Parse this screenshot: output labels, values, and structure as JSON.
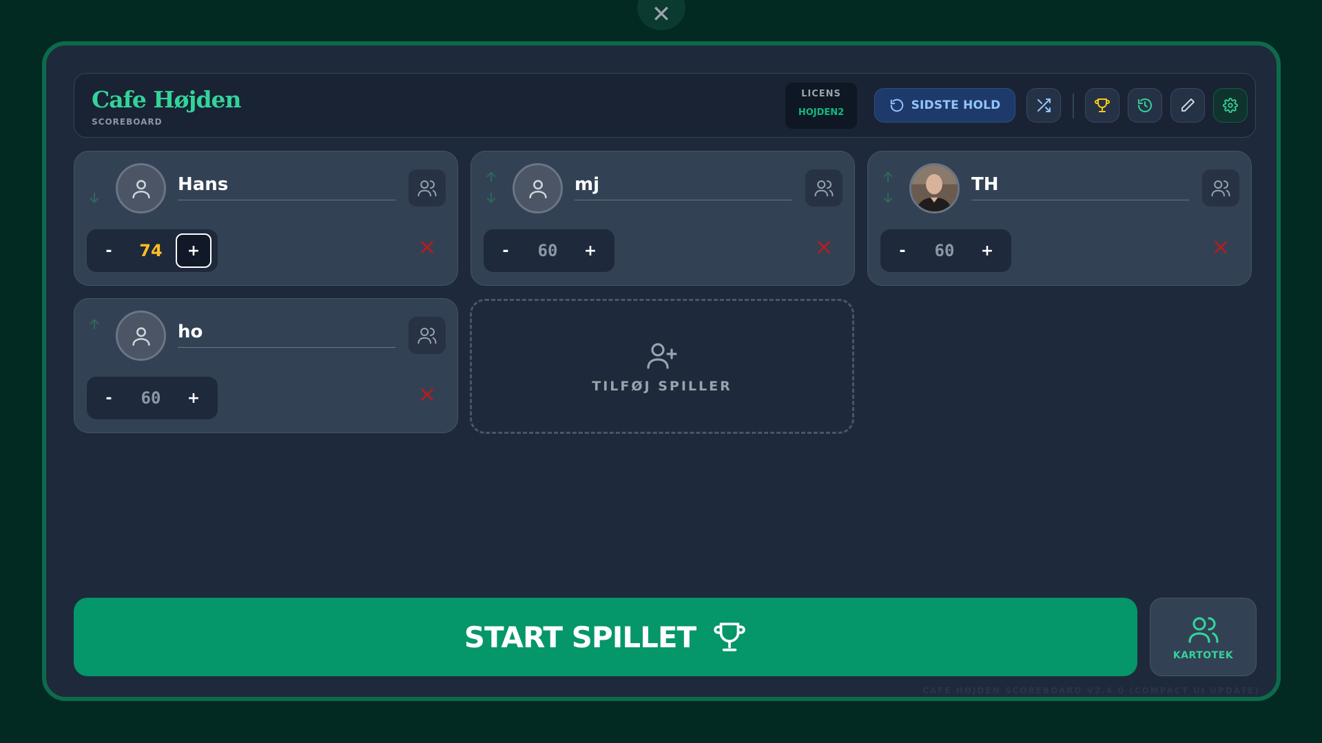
{
  "close_icon": "close-icon",
  "header": {
    "title": "Cafe Højden",
    "subtitle": "SCOREBOARD",
    "license_label": "LICENS",
    "license_value": "HOJDEN2",
    "last_team_label": "SIDSTE HOLD",
    "buttons": [
      "shuffle-icon",
      "trophy-icon",
      "history-icon",
      "pencil-icon",
      "gear-icon"
    ]
  },
  "players": [
    {
      "name": "Hans",
      "score": "74",
      "highlight": true,
      "avatar": "user-icon"
    },
    {
      "name": "mj",
      "score": "60",
      "highlight": false,
      "avatar": "user-icon"
    },
    {
      "name": "TH",
      "score": "60",
      "highlight": false,
      "avatar": "photo"
    },
    {
      "name": "ho",
      "score": "60",
      "highlight": false,
      "avatar": "user-icon"
    }
  ],
  "controls": {
    "minus": "-",
    "plus": "+"
  },
  "add_player_label": "TILFØJ SPILLER",
  "start_label": "START SPILLET",
  "roster_label": "KARTOTEK",
  "version_text": "CAFE HØJDEN SCOREBOARD V2.4.0 (COMPACT UI UPDATE)",
  "colors": {
    "accent": "#34d399",
    "start": "#059669",
    "score_highlight": "#fbbf24",
    "remove": "#b91c1c"
  }
}
